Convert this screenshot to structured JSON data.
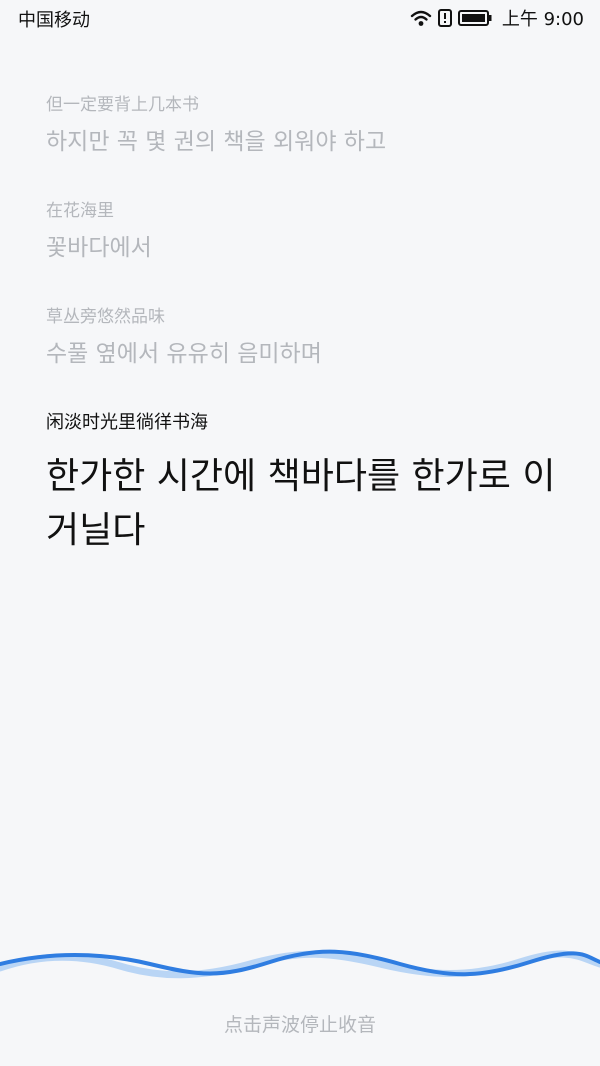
{
  "status_bar": {
    "carrier": "中国移动",
    "time": "上午 9:00",
    "icons": [
      "wifi-icon",
      "alert-badge-icon",
      "battery-icon"
    ]
  },
  "transcript": [
    {
      "source": "但一定要背上几本书",
      "translation": "하지만 꼭 몇 권의 책을 외워야 하고"
    },
    {
      "source": "在花海里",
      "translation": "꽃바다에서"
    },
    {
      "source": "草丛旁悠然品味",
      "translation": "수풀 옆에서 유유히 음미하며"
    }
  ],
  "current": {
    "source": "闲淡时光里徜徉书海",
    "translation": "한가한 시간에 책바다를 한가로 이 거닐다"
  },
  "bottom": {
    "hint": "点击声波停止收音"
  },
  "colors": {
    "background": "#f6f7f9",
    "faded_text": "#b4b7bc",
    "active_text": "#111111",
    "wave_primary": "#2f7de1",
    "wave_secondary": "#b9d5f5"
  }
}
